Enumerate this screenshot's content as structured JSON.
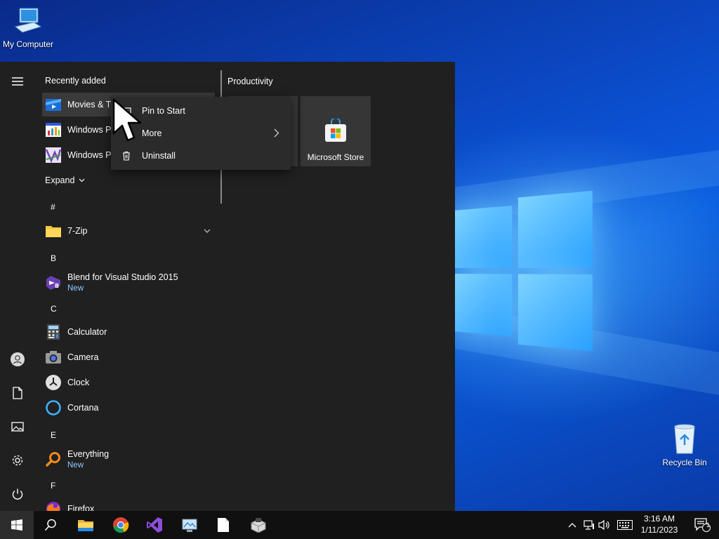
{
  "desktop": {
    "icons": [
      {
        "label": "My Computer",
        "icon": "my-computer-icon"
      },
      {
        "label": "Recycle Bin",
        "icon": "recycle-bin-icon"
      }
    ]
  },
  "start_menu": {
    "recently_added_title": "Recently added",
    "recent_apps": [
      {
        "label": "Movies & T",
        "icon": "movies-tv-icon"
      },
      {
        "label": "Windows Pe",
        "icon": "windows-performance-icon"
      },
      {
        "label": "Windows Pe",
        "icon": "windows-performance-analyzer-icon"
      }
    ],
    "expand_label": "Expand",
    "groups": [
      {
        "letter": "#",
        "apps": [
          {
            "label": "7-Zip",
            "badge": "",
            "icon": "folder-icon",
            "has_chevron": true
          }
        ]
      },
      {
        "letter": "B",
        "apps": [
          {
            "label": "Blend for Visual Studio 2015",
            "badge": "New",
            "icon": "blend-icon"
          }
        ]
      },
      {
        "letter": "C",
        "apps": [
          {
            "label": "Calculator",
            "badge": "",
            "icon": "calculator-icon"
          },
          {
            "label": "Camera",
            "badge": "",
            "icon": "camera-icon"
          },
          {
            "label": "Clock",
            "badge": "",
            "icon": "clock-icon"
          },
          {
            "label": "Cortana",
            "badge": "",
            "icon": "cortana-icon"
          }
        ]
      },
      {
        "letter": "E",
        "apps": [
          {
            "label": "Everything",
            "badge": "New",
            "icon": "everything-icon"
          }
        ]
      },
      {
        "letter": "F",
        "apps": [
          {
            "label": "Firefox",
            "badge": "",
            "icon": "firefox-icon"
          }
        ]
      }
    ],
    "tiles_group_title": "Productivity",
    "tiles": [
      {
        "label": "",
        "icon": ""
      },
      {
        "label": "Microsoft Store",
        "icon": "microsoft-store-icon"
      }
    ],
    "rail": [
      "hamburger-icon",
      "user-icon",
      "documents-icon",
      "pictures-icon",
      "settings-icon",
      "power-icon"
    ]
  },
  "context_menu": {
    "items": [
      {
        "label": "Pin to Start",
        "icon": "pin-icon"
      },
      {
        "label": "More",
        "icon": "",
        "submenu": true
      },
      {
        "label": "Uninstall",
        "icon": "trash-icon"
      }
    ]
  },
  "taskbar": {
    "apps": [
      "windows-start-icon",
      "search-icon",
      "file-explorer-icon",
      "chrome-icon",
      "visual-studio-icon",
      "control-panel-icon",
      "notepad-icon",
      "installer-icon"
    ],
    "tray": [
      "chevron-up-icon",
      "network-icon",
      "volume-icon",
      "keyboard-icon"
    ],
    "time": "3:16 AM",
    "date": "1/11/2023",
    "notification_count": "1"
  },
  "colors": {
    "start_bg": "#202020",
    "accent_link": "#8ec9ff",
    "taskbar_bg": "#101010"
  }
}
